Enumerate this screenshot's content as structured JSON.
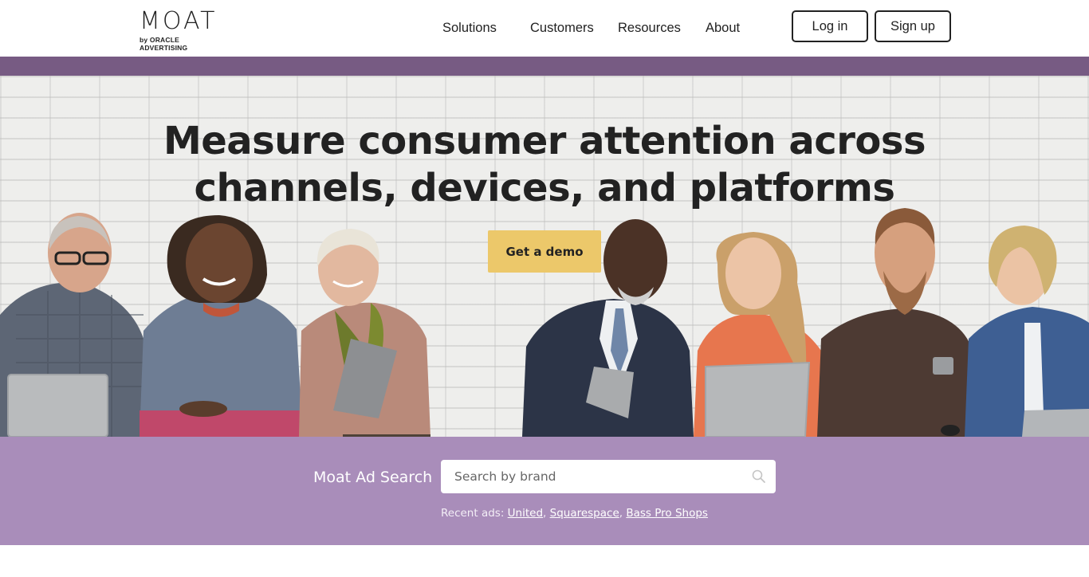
{
  "header": {
    "logo": {
      "wordmark": "MOAT",
      "subline": "by ORACLE ADVERTISING"
    },
    "nav": [
      {
        "label": "Solutions"
      },
      {
        "label": "Customers"
      },
      {
        "label": "Resources"
      },
      {
        "label": "About"
      }
    ],
    "login_label": "Log in",
    "signup_label": "Sign up"
  },
  "hero": {
    "headline_line1": "Measure consumer attention across",
    "headline_line2": "channels, devices, and platforms",
    "cta_label": "Get a demo"
  },
  "ad_search": {
    "label": "Moat Ad Search",
    "placeholder": "Search by brand",
    "value": "",
    "icon": "search-icon",
    "recent_prefix": "Recent ads:",
    "recent_links": [
      "United",
      "Squarespace",
      "Bass Pro Shops"
    ]
  },
  "colors": {
    "header_strip": "#775b83",
    "search_band": "#a98dba",
    "cta": "#ecc86a",
    "text": "#222222"
  }
}
